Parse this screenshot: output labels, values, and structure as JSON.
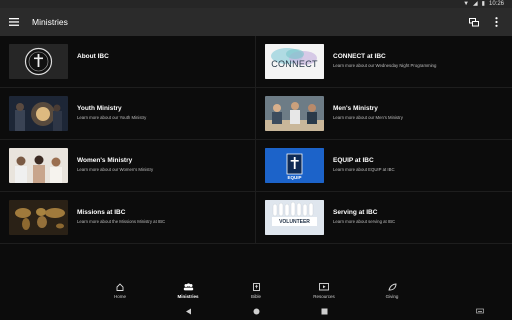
{
  "status": {
    "time": "10:26"
  },
  "appbar": {
    "title": "Ministries"
  },
  "tiles": [
    {
      "title": "About IBC",
      "subtitle": "",
      "thumb": "seal"
    },
    {
      "title": "CONNECT at IBC",
      "subtitle": "Learn more about our Wednesday Night Programming",
      "thumb": "connect",
      "thumb_text": "CONNECT"
    },
    {
      "title": "Youth Ministry",
      "subtitle": "Learn more about our Youth Ministry",
      "thumb": "youth"
    },
    {
      "title": "Men's Ministry",
      "subtitle": "Learn more about our Men's Ministry",
      "thumb": "men"
    },
    {
      "title": "Women's Ministry",
      "subtitle": "Learn more about our Women's Ministry",
      "thumb": "women"
    },
    {
      "title": "EQUIP at IBC",
      "subtitle": "Learn more about EQUIP at IBC",
      "thumb": "equip",
      "thumb_text": "EQUIP"
    },
    {
      "title": "Missions at IBC",
      "subtitle": "Learn more about the Missions Ministry at IBC",
      "thumb": "missions"
    },
    {
      "title": "Serving at IBC",
      "subtitle": "Learn more about serving at IBC",
      "thumb": "volunteer",
      "thumb_text": "VOLUNTEER"
    }
  ],
  "bottom_nav": [
    {
      "label": "Home",
      "icon": "home-icon",
      "active": false
    },
    {
      "label": "Ministries",
      "icon": "people-icon",
      "active": true
    },
    {
      "label": "Bible",
      "icon": "bible-icon",
      "active": false
    },
    {
      "label": "Resources",
      "icon": "play-icon",
      "active": false
    },
    {
      "label": "Giving",
      "icon": "leaf-icon",
      "active": false
    }
  ],
  "colors": {
    "appbar": "#2b2b2b",
    "background": "#0c0c0c",
    "equip_blue": "#1c63c9"
  }
}
